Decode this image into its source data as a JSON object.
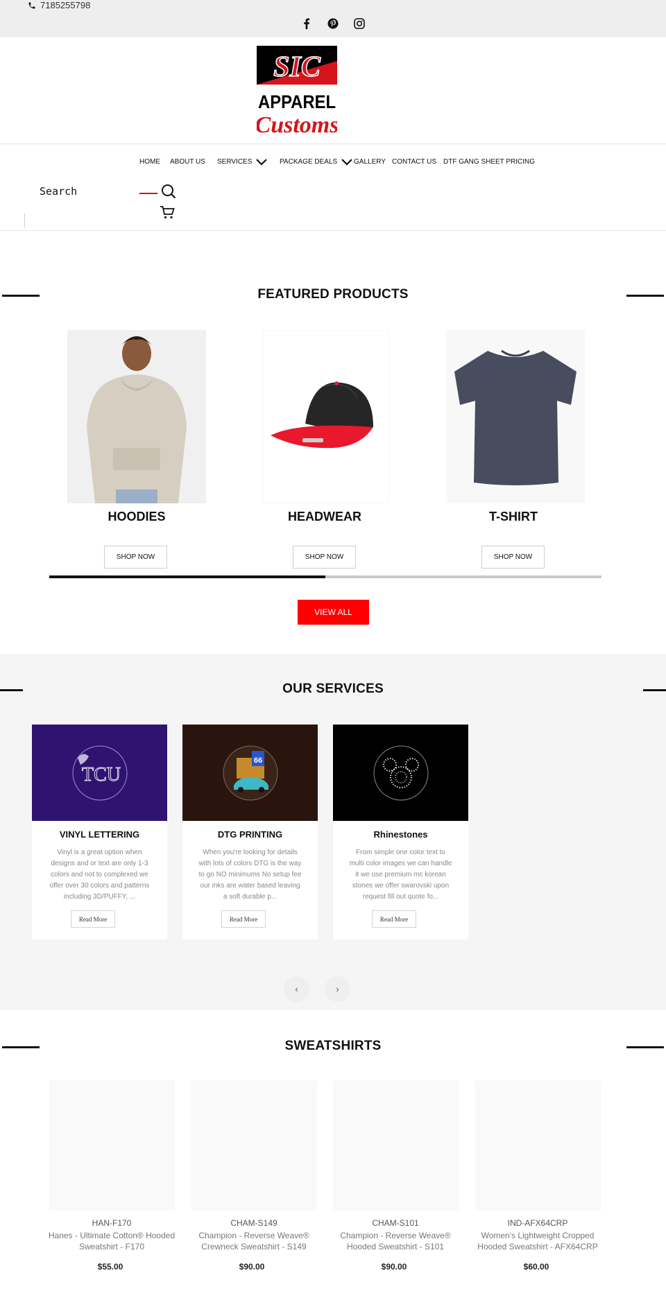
{
  "topbar": {
    "phone": "7185255798",
    "socials": [
      "facebook-icon",
      "pinterest-icon",
      "instagram-icon"
    ]
  },
  "logo": {
    "line1": "SIC",
    "line2": "APPAREL",
    "line3": "Customs"
  },
  "nav": {
    "items": [
      "HOME",
      "ABOUT US",
      "SERVICES",
      "PACKAGE DEALS",
      "GALLERY",
      "CONTACT US",
      "DTF GANG SHEET PRICING"
    ],
    "active": "HOME",
    "search_label": "Search"
  },
  "featured": {
    "title": "FEATURED PRODUCTS",
    "products": [
      {
        "name": "HOODIES",
        "button": "SHOP NOW"
      },
      {
        "name": "HEADWEAR",
        "button": "SHOP NOW"
      },
      {
        "name": "T-SHIRT",
        "button": "SHOP NOW"
      }
    ],
    "slider_progress": 0.5,
    "view_all": "VIEW ALL"
  },
  "services": {
    "title": "OUR SERVICES",
    "cards": [
      {
        "title": "VINYL LETTERING",
        "desc": "Vinyl is a great option when designs and or text are only 1-3 colors and not to complexed we offer over 30 colors and patterns including 3D/PUFFY, ...",
        "button": "Read More",
        "image_text": "TCU"
      },
      {
        "title": "DTG PRINTING",
        "desc": "When you're looking for details with lots of colors DTG is the way to go NO minimums No setup fee our inks are water based leaving a soft durable p...",
        "button": "Read More",
        "image_text": "66"
      },
      {
        "title": "Rhinestones",
        "desc": "From simple one color text to multi color images we can handle it we use premium mc korean stones we offer swarovski upon request fill out quote fo...",
        "button": "Read More",
        "image_text": ""
      }
    ],
    "prev": "‹",
    "next": "›"
  },
  "sweatshirts": {
    "title": "SWEATSHIRTS",
    "items": [
      {
        "sku": "HAN-F170",
        "name": "Hanes - Ultimate Cotton® Hooded Sweatshirt - F170",
        "price": "$55.00"
      },
      {
        "sku": "CHAM-S149",
        "name": "Champion - Reverse Weave® Crewneck Sweatshirt - S149",
        "price": "$90.00"
      },
      {
        "sku": "CHAM-S101",
        "name": "Champion - Reverse Weave® Hooded Sweatshirt - S101",
        "price": "$90.00"
      },
      {
        "sku": "IND-AFX64CRP",
        "name": "Women's Lightweight Cropped Hooded Sweatshirt - AFX64CRP",
        "price": "$60.00"
      }
    ]
  },
  "colors": {
    "accent_red": "#ff0000",
    "logo_red": "#d6141c",
    "vinyl_bg": "#2e1470",
    "dtg_bg": "#2a150e",
    "rhinestone_bg": "#000000"
  }
}
